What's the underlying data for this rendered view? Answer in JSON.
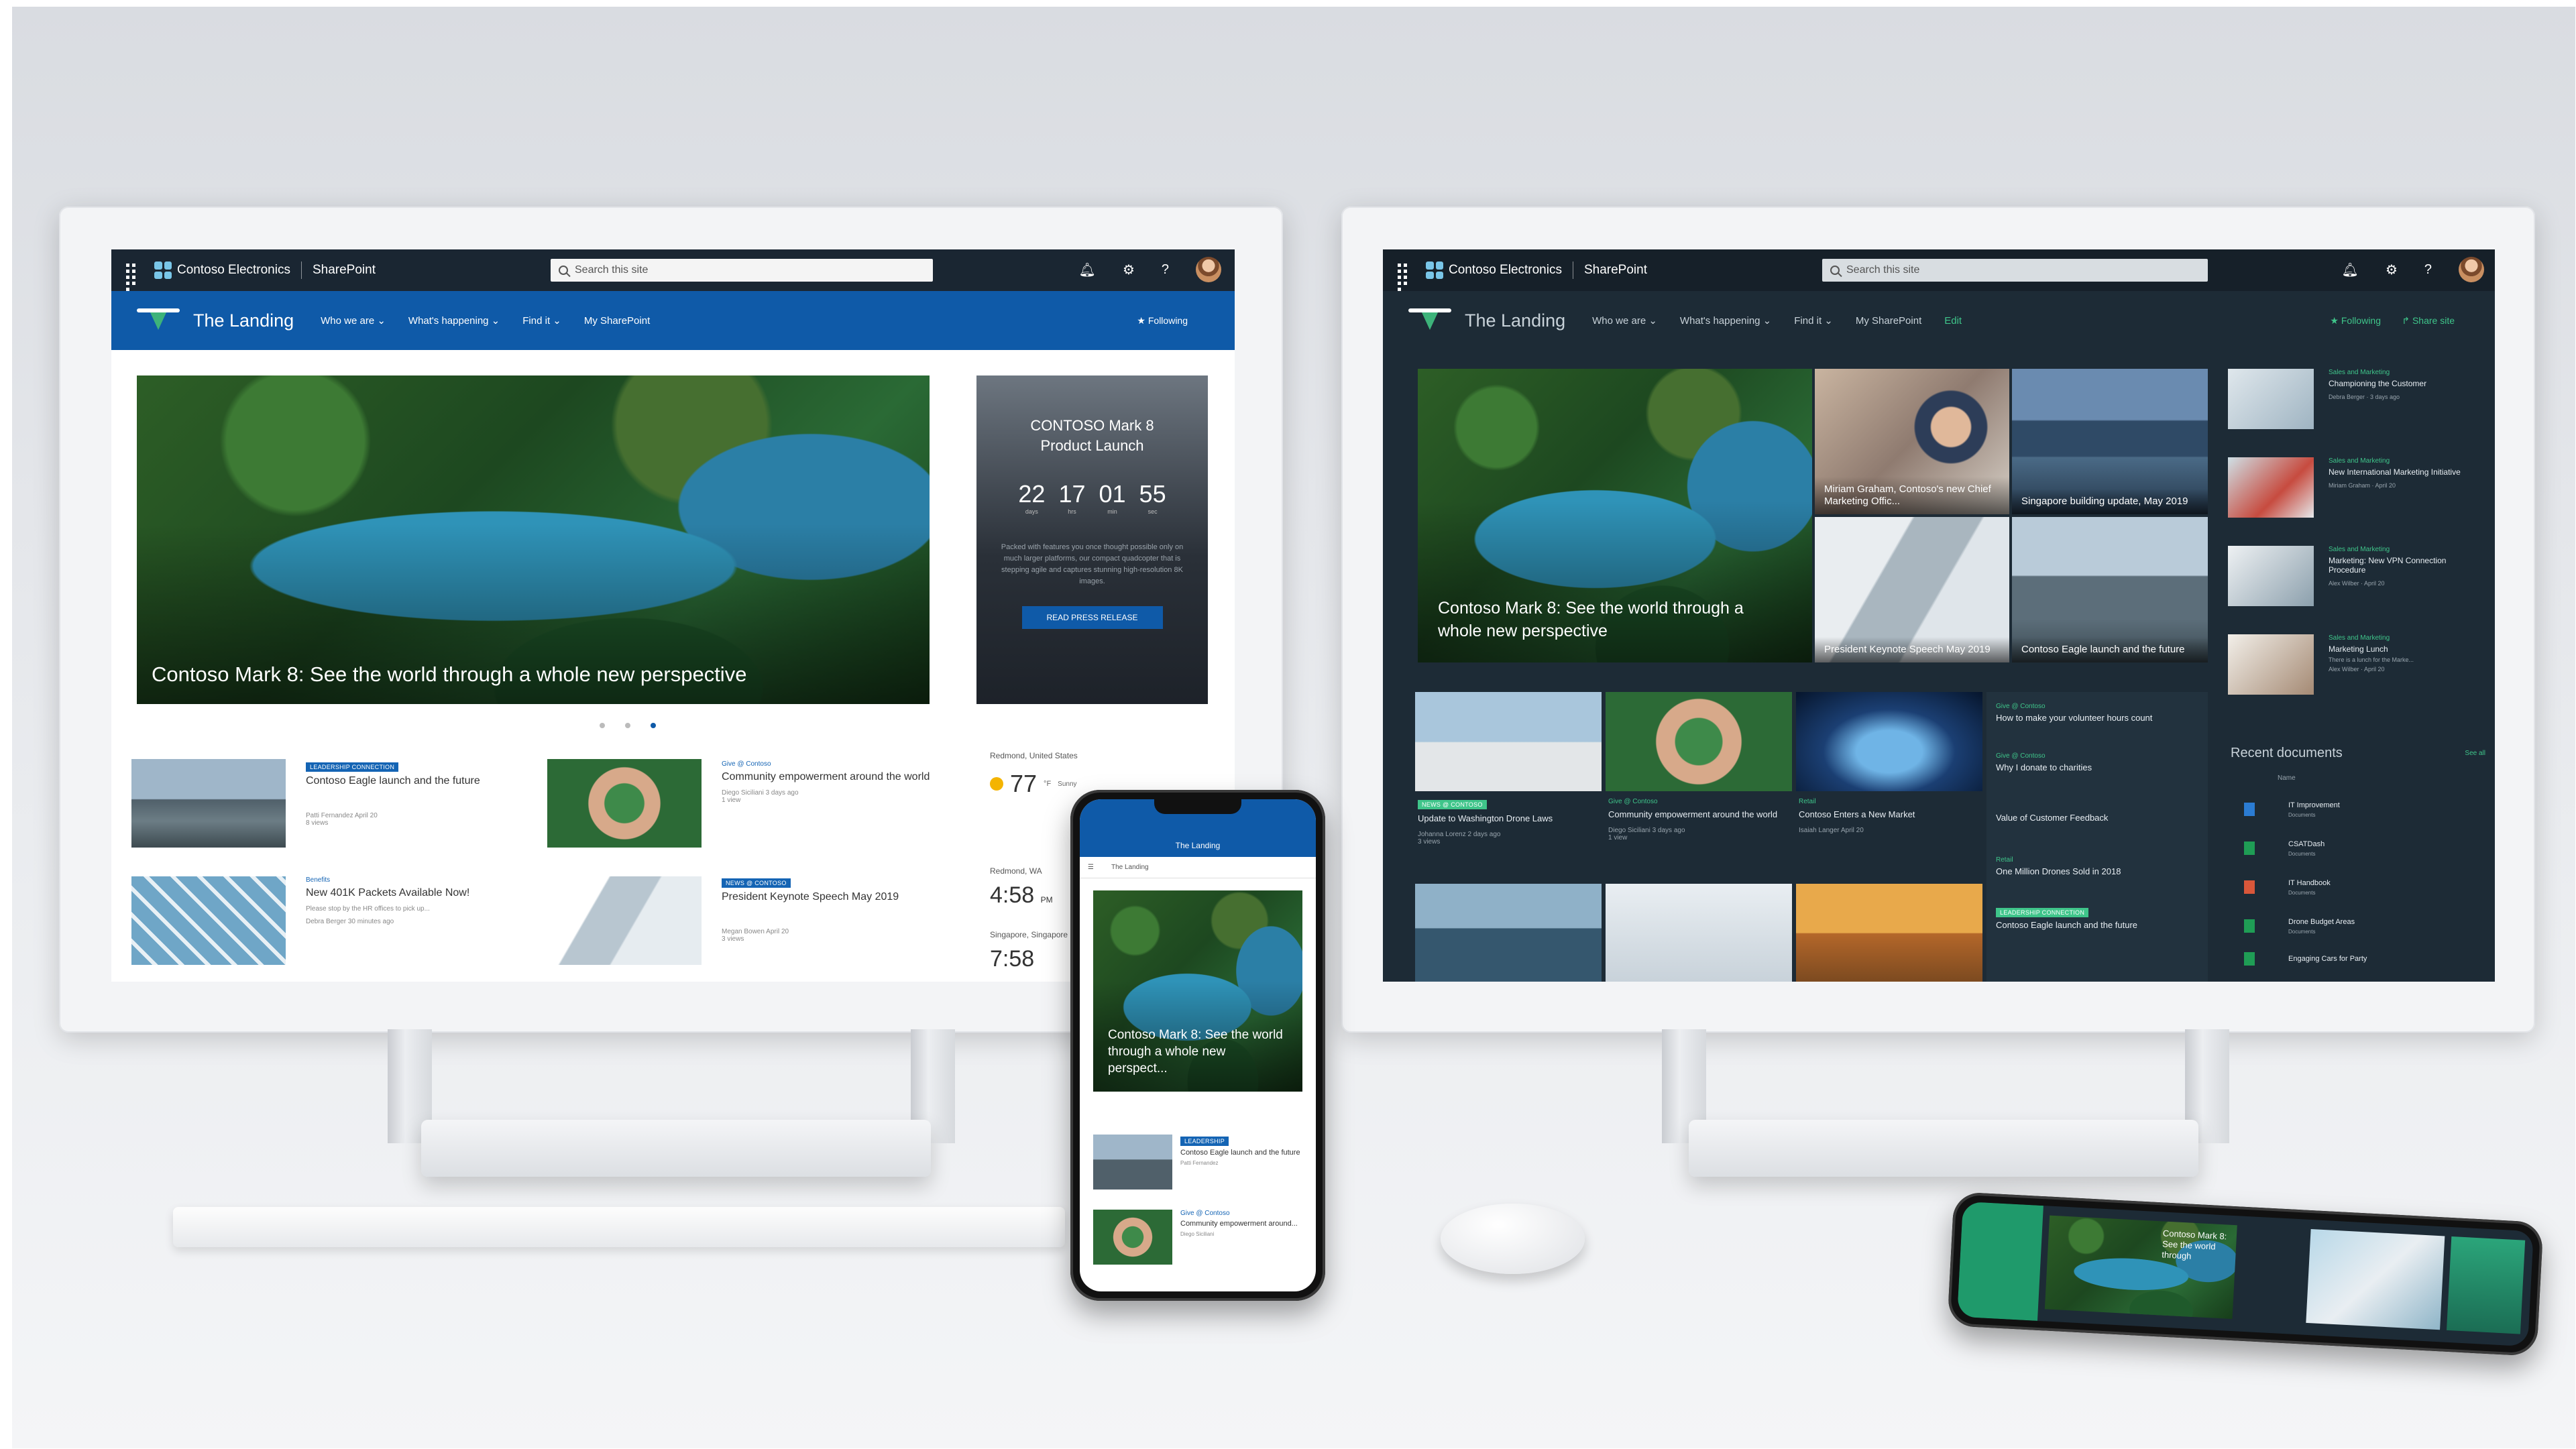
{
  "left_site": {
    "suite": {
      "brand": "Contoso Electronics",
      "app": "SharePoint",
      "search_placeholder": "Search this site"
    },
    "hub": {
      "title": "The Landing",
      "nav": [
        "Who we are ⌄",
        "What's happening ⌄",
        "Find it ⌄",
        "My SharePoint"
      ],
      "following": "★ Following"
    },
    "hero": {
      "title": "Contoso Mark 8: See the world through a whole new perspective"
    },
    "countdown": {
      "title": "CONTOSO Mark 8 Product Launch",
      "days": "22",
      "hours": "17",
      "minutes": "01",
      "seconds": "55",
      "unit_days": "days",
      "unit_hours": "hrs",
      "unit_min": "min",
      "unit_sec": "sec",
      "body": "Packed with features you once thought possible only on much larger platforms, our compact quadcopter that is stepping agile and captures stunning high-resolution 8K images.",
      "cta": "READ PRESS RELEASE"
    },
    "news": [
      {
        "badge": "LEADERSHIP CONNECTION",
        "title": "Contoso Eagle launch and the future",
        "author": "Patti Fernandez",
        "date": "April 20",
        "views": "8 views"
      },
      {
        "category": "Give @ Contoso",
        "title": "Community empowerment around the world",
        "author": "Diego Siciliani",
        "date": "3 days ago",
        "views": "1 view"
      },
      {
        "category": "Benefits",
        "title": "New 401K Packets Available Now!",
        "desc": "Please stop by the HR offices to pick up...",
        "author": "Debra Berger",
        "date": "30 minutes ago"
      },
      {
        "badge": "NEWS @ CONTOSO",
        "title": "President Keynote Speech May 2019",
        "author": "Megan Bowen",
        "date": "April 20",
        "views": "3 views"
      }
    ],
    "weather": [
      {
        "place": "Redmond, United States",
        "temp": "77",
        "unit": "°F",
        "cond": "Sunny"
      },
      {
        "place": "Redmond, WA",
        "time": "4:58",
        "ampm": "PM"
      },
      {
        "place": "Singapore, Singapore",
        "time": "7:58"
      }
    ]
  },
  "right_site": {
    "suite": {
      "brand": "Contoso Electronics",
      "app": "SharePoint",
      "search_placeholder": "Search this site"
    },
    "hub": {
      "title": "The Landing",
      "nav": [
        "Who we are ⌄",
        "What's happening ⌄",
        "Find it ⌄",
        "My SharePoint",
        "Edit"
      ],
      "following": "★ Following",
      "share": "↱ Share site"
    },
    "hero": {
      "title": "Contoso Mark 8: See the world through a whole new perspective"
    },
    "tiles": [
      {
        "title": "Miriam Graham, Contoso's new Chief Marketing Offic..."
      },
      {
        "title": "Singapore building update, May 2019"
      },
      {
        "title": "President Keynote Speech May 2019"
      },
      {
        "title": "Contoso Eagle launch and the future"
      }
    ],
    "news": [
      {
        "badge": "NEWS @ CONTOSO",
        "title": "Update to Washington Drone Laws",
        "author": "Johanna Lorenz",
        "date": "2 days ago",
        "views": "3 views"
      },
      {
        "category": "Give @ Contoso",
        "title": "Community empowerment around the world",
        "author": "Diego Siciliani",
        "date": "3 days ago",
        "views": "1 view"
      },
      {
        "category": "Retail",
        "title": "Contoso Enters a New Market",
        "author": "Isaiah Langer",
        "date": "April 20"
      }
    ],
    "textnews": [
      {
        "category": "Give @ Contoso",
        "title": "How to make your volunteer hours count"
      },
      {
        "category": "Give @ Contoso",
        "title": "Why I donate to charities"
      },
      {
        "category": "",
        "title": "Value of Customer Feedback"
      },
      {
        "category": "Retail",
        "title": "One Million Drones Sold in 2018"
      },
      {
        "badge": "LEADERSHIP CONNECTION",
        "title": "Contoso Eagle launch and the future"
      }
    ],
    "sidebar": [
      {
        "category": "Sales and Marketing",
        "title": "Championing the Customer",
        "meta": "Debra Berger · 3 days ago"
      },
      {
        "category": "Sales and Marketing",
        "title": "New International Marketing Initiative",
        "meta": "Miriam Graham · April 20"
      },
      {
        "category": "Sales and Marketing",
        "title": "Marketing: New VPN Connection Procedure",
        "meta": "Alex Wilber · April 20"
      },
      {
        "category": "Sales and Marketing",
        "title": "Marketing Lunch",
        "desc": "There is a lunch for the Marke...",
        "meta": "Alex Wilber · April 20"
      }
    ],
    "docs": {
      "title": "Recent documents",
      "see_all": "See all",
      "header": "Name",
      "items": [
        "IT Improvement",
        "CSATDash",
        "IT Handbook",
        "Drone Budget Areas",
        "Engaging Cars for Party"
      ],
      "meta": "Documents"
    }
  },
  "phone": {
    "title": "The Landing",
    "subtitle": "The Landing",
    "hero": "Contoso Mark 8: See the world through a whole new perspect...",
    "news": [
      {
        "badge": "LEADERSHIP",
        "title": "Contoso Eagle launch and the future",
        "author": "Patti Fernandez"
      },
      {
        "category": "Give @ Contoso",
        "title": "Community empowerment around...",
        "author": "Diego Siciliani"
      }
    ]
  },
  "phone2": {
    "hero": "Contoso Mark 8: See the world through"
  },
  "colors": {
    "sp_blue": "#0f5aa8",
    "suite_dark": "#203140",
    "dark_bg": "#1d2b36",
    "accent_green": "#3fc58a"
  }
}
